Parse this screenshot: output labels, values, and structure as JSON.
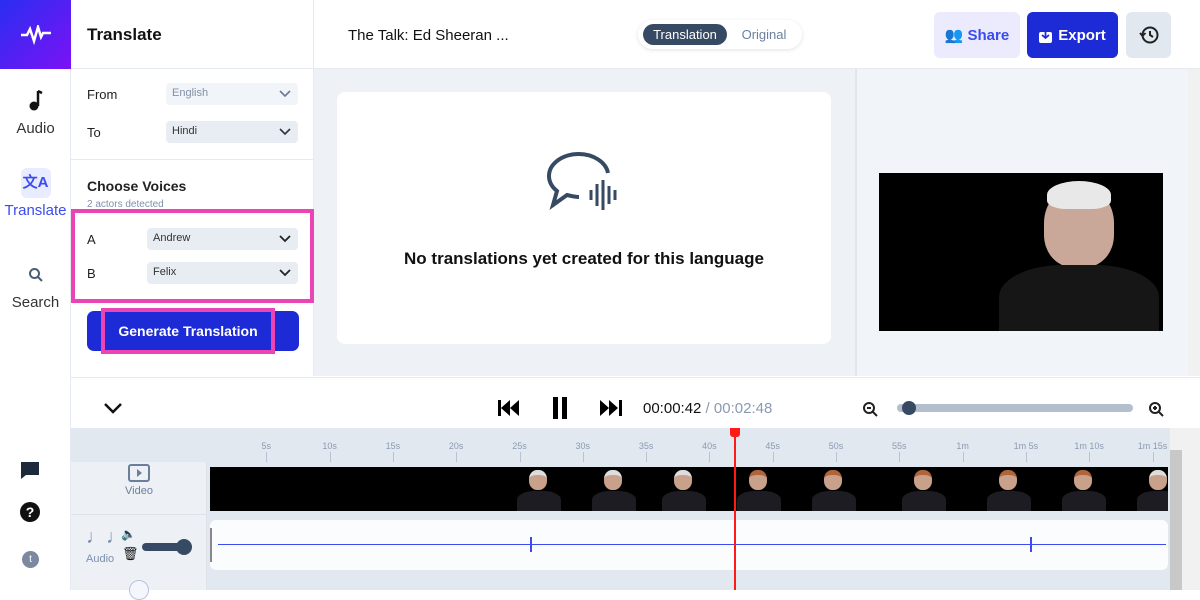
{
  "rail": {
    "items": [
      {
        "label": "Audio"
      },
      {
        "label": "Translate"
      },
      {
        "label": "Search"
      }
    ],
    "avatar_letter": "t"
  },
  "panel": {
    "title": "Translate",
    "from_label": "From",
    "from_value": "English",
    "to_label": "To",
    "to_value": "Hindi",
    "voices_title": "Choose Voices",
    "voices_sub": "2 actors detected",
    "actors": [
      {
        "id": "A",
        "voice": "Andrew"
      },
      {
        "id": "B",
        "voice": "Felix"
      }
    ],
    "generate_label": "Generate Translation"
  },
  "topbar": {
    "title": "The Talk: Ed Sheeran ...",
    "toggle": [
      "Translation",
      "Original"
    ],
    "share": "Share",
    "export": "Export"
  },
  "main": {
    "empty_message": "No translations yet created for this language"
  },
  "player": {
    "current": "00:00:42",
    "separator": " / ",
    "total": "00:02:48",
    "zoom_level": 0.03
  },
  "timeline": {
    "ticks": [
      "5s",
      "10s",
      "15s",
      "20s",
      "25s",
      "30s",
      "35s",
      "40s",
      "45s",
      "50s",
      "55s",
      "1m",
      "1m 5s",
      "1m 10s",
      "1m 15s"
    ],
    "playhead_seconds": 42,
    "video_label": "Video",
    "audio_label": "Audio"
  },
  "colors": {
    "accent": "#1c2bd6",
    "pink": "#ea44b5",
    "playhead": "#ff1a1a"
  }
}
